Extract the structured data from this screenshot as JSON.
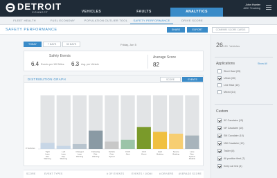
{
  "brand": {
    "name": "DETROIT",
    "sub": "CONNECT"
  },
  "nav": {
    "tabs": [
      "VEHICLES",
      "FAULTS",
      "ANALYTICS"
    ],
    "active": 2
  },
  "user": {
    "name": "John Hunter",
    "company": "ABC Trucking"
  },
  "subnav": {
    "items": [
      "FLEET HEALTH",
      "FUEL ECONOMY",
      "POPULATION OUTLIER TOOL",
      "SAFETY PERFORMANCE",
      "DRIVE SCORE"
    ],
    "active": 3
  },
  "page": {
    "title": "SAFETY PERFORMANCE",
    "share": "SHARE",
    "export": "EXPORT",
    "compare": "COMPARE SCORE CARDS"
  },
  "dates": {
    "buttons": [
      "TODAY",
      "7 DAYS",
      "30 DAYS"
    ],
    "active": 0,
    "label": "Friday, Jun 5"
  },
  "stats": {
    "events_label": "Safety Events",
    "per_mile": "6.4",
    "per_mile_label": "Events per 100 Miles",
    "per_vehicle": "6.3",
    "per_vehicle_label": "Avg. per Vehicle",
    "score_label": "Average Score",
    "score": "82"
  },
  "graph": {
    "title": "DISTRIBUTION GRAPH",
    "btn_score": "SCORE",
    "btn_events": "EVENTS",
    "y_label": "# Vehicles"
  },
  "chart_data": {
    "type": "bar",
    "categories": [
      "Tight Lane Dev. Warning",
      "Left Lane Dep. Warning",
      "Changed Lane Warning",
      "Following Dist. Warning",
      "Vehicle Over Speed",
      "FCW Alert",
      "CCO Event",
      "Hard Braking",
      "Severe Braking",
      "Lane Dep. System Disable"
    ],
    "series": [
      {
        "name": "",
        "values": [
          10,
          5,
          8,
          30,
          12,
          15,
          36,
          28,
          25,
          22
        ]
      },
      {
        "name": "",
        "values": [
          88,
          88,
          88,
          88,
          88,
          88,
          88,
          88,
          88,
          88
        ]
      }
    ],
    "colors": [
      "#c7d6e6",
      "#c7d6e6",
      "#b8c4ce",
      "#8a9aa4",
      "#c8c8c8",
      "#9bc4a8",
      "#7a9a2a",
      "#f0c040",
      "#f7ce72",
      "#a8b4bc"
    ],
    "ylim": [
      0,
      100
    ]
  },
  "table": {
    "headers": [
      "SCORE",
      "EVENT TYPES",
      "# OF EVENTS",
      "EVENTS / 100MI",
      "# DRIVERS",
      "AVERAGE SCORE"
    ]
  },
  "sidebar": {
    "vehicles": "26",
    "vehicles_of": "/ 80",
    "vehicles_label": "Vehicles",
    "applications_title": "Applications",
    "applications_link": "Show All",
    "applications": [
      {
        "label": "Short Haul (25)",
        "checked": false
      },
      {
        "label": "Urban (30)",
        "checked": true
      },
      {
        "label": "Line Haul (15)",
        "checked": false
      },
      {
        "label": "Mixed (14)",
        "checked": false
      }
    ],
    "custom_title": "Custom",
    "custom": [
      {
        "label": "5C Cavalaire (15)",
        "checked": true
      },
      {
        "label": "NF Cavalaire (10)",
        "checked": true
      },
      {
        "label": "SM Cavalaire (10)",
        "checked": true
      },
      {
        "label": "NW Cavalaire (10)",
        "checked": true
      },
      {
        "label": "Trailer (8)",
        "checked": true
      },
      {
        "label": "All position fleet (7)",
        "checked": true
      },
      {
        "label": "Keep car test (4)",
        "checked": true
      }
    ]
  }
}
